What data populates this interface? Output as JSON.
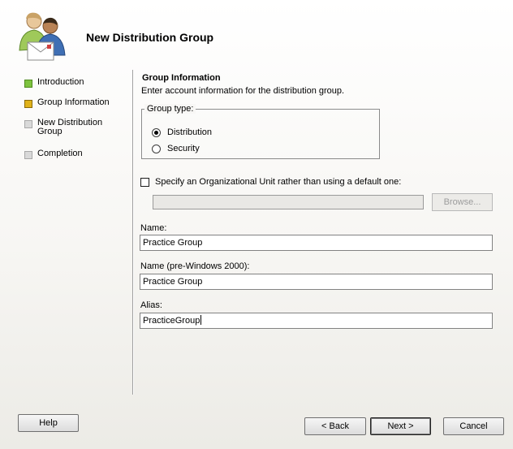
{
  "wizard": {
    "title": "New Distribution Group",
    "icon": "users-envelope-icon"
  },
  "nav": {
    "items": [
      {
        "label": "Introduction",
        "state": "completed",
        "color": "#7ec33f"
      },
      {
        "label": "Group Information",
        "state": "current",
        "color": "#e0b21a"
      },
      {
        "label": "New Distribution Group",
        "state": "pending",
        "color": "#d9d9d9"
      },
      {
        "label": "Completion",
        "state": "pending",
        "color": "#d9d9d9"
      }
    ]
  },
  "section": {
    "title": "Group Information",
    "description": "Enter account information for the distribution group."
  },
  "group_type": {
    "legend": "Group type:",
    "options": [
      {
        "label": "Distribution",
        "checked": true
      },
      {
        "label": "Security",
        "checked": false
      }
    ]
  },
  "org_unit": {
    "checkbox_label": "Specify an Organizational Unit rather than using a default one:",
    "checked": false,
    "value": "",
    "browse_label": "Browse..."
  },
  "fields": {
    "name": {
      "label": "Name:",
      "value": "Practice Group"
    },
    "name_pre2000": {
      "label": "Name (pre-Windows 2000):",
      "value": "Practice Group"
    },
    "alias": {
      "label": "Alias:",
      "value": "PracticeGroup"
    }
  },
  "buttons": {
    "help": "Help",
    "back": "< Back",
    "next": "Next >",
    "cancel": "Cancel"
  }
}
